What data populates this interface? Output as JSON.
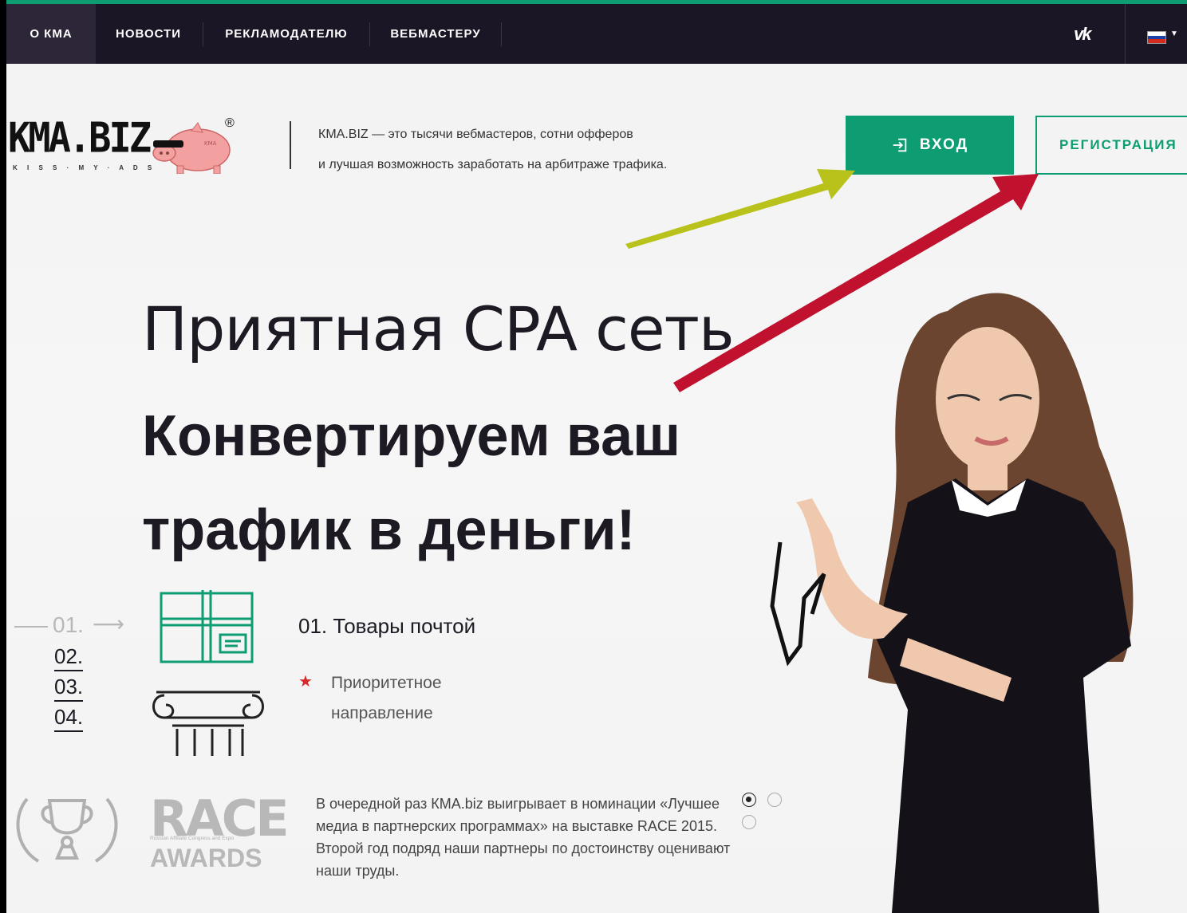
{
  "nav": {
    "items": [
      "О КМА",
      "НОВОСТИ",
      "РЕКЛАМОДАТЕЛЮ",
      "ВЕБМАСТЕРУ"
    ],
    "vk_label": "VK"
  },
  "logo": {
    "text": "KMA.BIZ",
    "tagline": "K I S S · M Y · A D S",
    "reg": "®"
  },
  "header": {
    "tagline_line1": "КМА.BIZ — это тысячи вебмастеров, сотни офферов",
    "tagline_line2": "и лучшая возможность заработать на арбитраже трафика.",
    "login_label": "ВХОД",
    "register_label": "РЕГИСТРАЦИЯ"
  },
  "hero": {
    "line1": "Приятная CPA сеть",
    "line2": "Конвертируем ваш трафик в деньги!"
  },
  "steps": {
    "active": "01.",
    "others": [
      "02.",
      "03.",
      "04."
    ]
  },
  "category": {
    "title": "01. Товары почтой",
    "priority_line1": "Приоритетное",
    "priority_line2": "направление"
  },
  "award": {
    "race_logo": "RACE",
    "race_sub": "Russian Affiliate Congress and Expo",
    "race_awards": "AWARDS",
    "text": "В очередной раз КМА.biz выигрывает в номинации «Лучшее медиа в партнерских программах» на выставке RACE 2015. Второй год подряд наши партнеры по достоинству оценивают наши труды."
  },
  "slider": {
    "active_index": 0,
    "count": 3
  },
  "colors": {
    "accent": "#0e9d72",
    "nav_bg": "#1b1626",
    "arrow_yellow": "#b9c21a",
    "arrow_red": "#c0122e",
    "star": "#d72a2a"
  }
}
